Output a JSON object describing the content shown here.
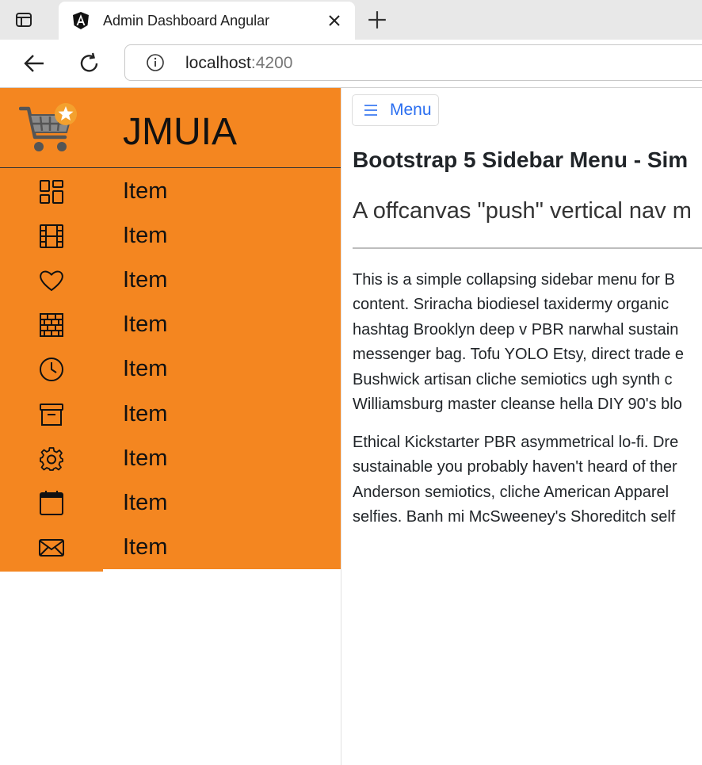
{
  "browser": {
    "tab_title": "Admin Dashboard Angular",
    "address_host": "localhost",
    "address_port": ":4200"
  },
  "sidebar": {
    "brand": "JMUIA",
    "items": [
      {
        "label": "Item",
        "icon": "grid-icon"
      },
      {
        "label": "Item",
        "icon": "film-icon"
      },
      {
        "label": "Item",
        "icon": "heart-icon"
      },
      {
        "label": "Item",
        "icon": "bricks-icon"
      },
      {
        "label": "Item",
        "icon": "clock-icon"
      },
      {
        "label": "Item",
        "icon": "archive-icon"
      },
      {
        "label": "Item",
        "icon": "gear-icon"
      },
      {
        "label": "Item",
        "icon": "calendar-icon"
      },
      {
        "label": "Item",
        "icon": "envelope-icon"
      }
    ],
    "accent_color": "#f48620"
  },
  "main": {
    "menu_button": "Menu",
    "title": "Bootstrap 5 Sidebar Menu - Sim",
    "subtitle": "A offcanvas \"push\" vertical nav m",
    "paragraph1": [
      "This is a simple collapsing sidebar menu for B",
      "content. Sriracha biodiesel taxidermy organic",
      "hashtag Brooklyn deep v PBR narwhal sustain",
      "messenger bag. Tofu YOLO Etsy, direct trade e",
      "Bushwick artisan cliche semiotics ugh synth c",
      "Williamsburg master cleanse hella DIY 90's blo"
    ],
    "paragraph2": [
      "Ethical Kickstarter PBR asymmetrical lo-fi. Dre",
      "sustainable you probably haven't heard of ther",
      "Anderson semiotics, cliche American Apparel",
      "selfies. Banh mi McSweeney's Shoreditch self"
    ]
  }
}
